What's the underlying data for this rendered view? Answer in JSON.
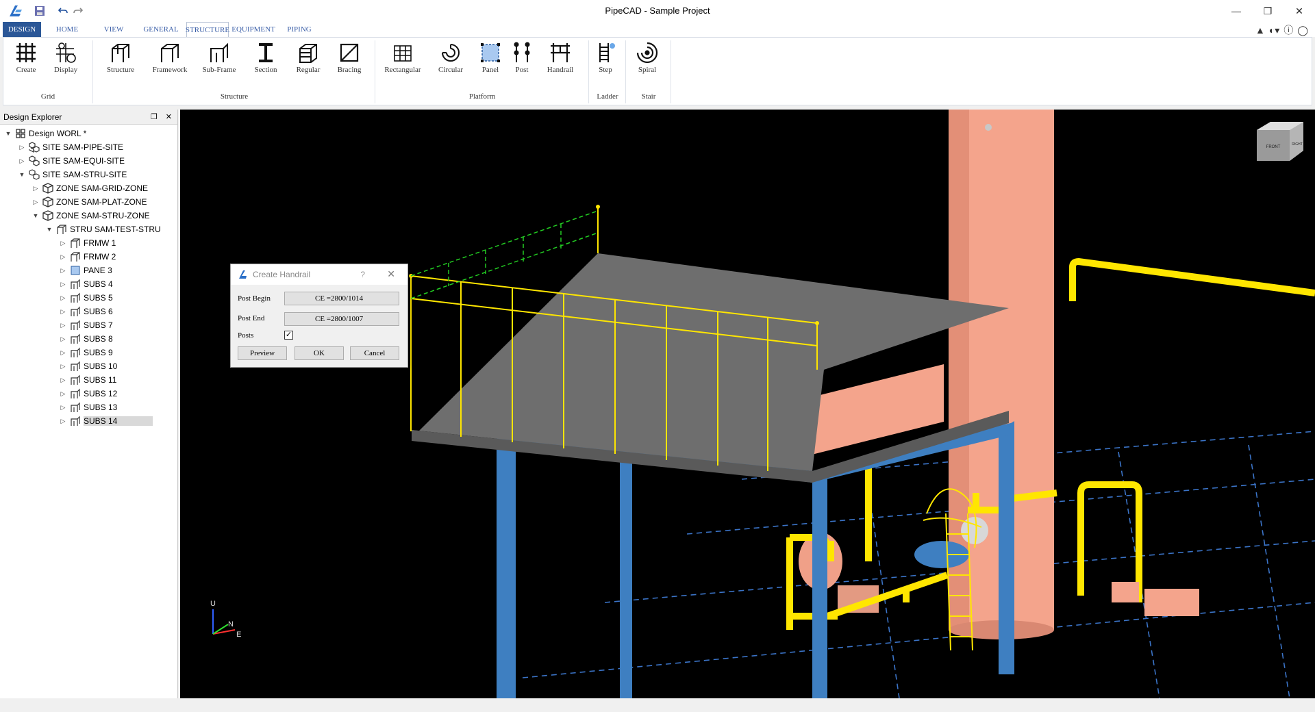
{
  "window": {
    "title": "PipeCAD - Sample Project"
  },
  "tabs": {
    "design": "DESIGN",
    "items": [
      "HOME",
      "VIEW",
      "GENERAL",
      "STRUCTURE",
      "EQUIPMENT",
      "PIPING"
    ],
    "active": "STRUCTURE"
  },
  "ribbon": {
    "groups": {
      "grid": "Grid",
      "structure": "Structure",
      "platform": "Platform",
      "ladder": "Ladder",
      "stair": "Stair"
    },
    "buttons": {
      "create": "Create",
      "display": "Display",
      "structure": "Structure",
      "framework": "Framework",
      "subframe": "Sub-Frame",
      "section": "Section",
      "regular": "Regular",
      "bracing": "Bracing",
      "rectangular": "Rectangular",
      "circular": "Circular",
      "panel": "Panel",
      "post": "Post",
      "handrail": "Handrail",
      "step": "Step",
      "spiral": "Spiral"
    }
  },
  "explorer": {
    "title": "Design Explorer",
    "nodes": [
      "Design WORL *",
      "SITE SAM-PIPE-SITE",
      "SITE SAM-EQUI-SITE",
      "SITE SAM-STRU-SITE",
      "ZONE SAM-GRID-ZONE",
      "ZONE SAM-PLAT-ZONE",
      "ZONE SAM-STRU-ZONE",
      "STRU SAM-TEST-STRU",
      "FRMW 1",
      "FRMW 2",
      "PANE 3",
      "SUBS 4",
      "SUBS 5",
      "SUBS 6",
      "SUBS 7",
      "SUBS 8",
      "SUBS 9",
      "SUBS 10",
      "SUBS 11",
      "SUBS 12",
      "SUBS 13",
      "SUBS 14"
    ]
  },
  "dialog": {
    "title": "Create Handrail",
    "post_begin_label": "Post Begin",
    "post_begin_value": "CE =2800/1014",
    "post_end_label": "Post End",
    "post_end_value": "CE =2800/1007",
    "posts_label": "Posts",
    "posts_checked": true,
    "preview": "Preview",
    "ok": "OK",
    "cancel": "Cancel"
  },
  "viewport": {
    "axis": {
      "u": "U",
      "n": "N",
      "e": "E"
    },
    "viewcube": {
      "front": "FRONT",
      "right": "RIGHT"
    }
  },
  "colors": {
    "accent": "#2b5797",
    "steel": "#3e7fc1",
    "pipe": "#ffe600",
    "vessel": "#f4a48c",
    "deck": "#6e6e6e"
  }
}
